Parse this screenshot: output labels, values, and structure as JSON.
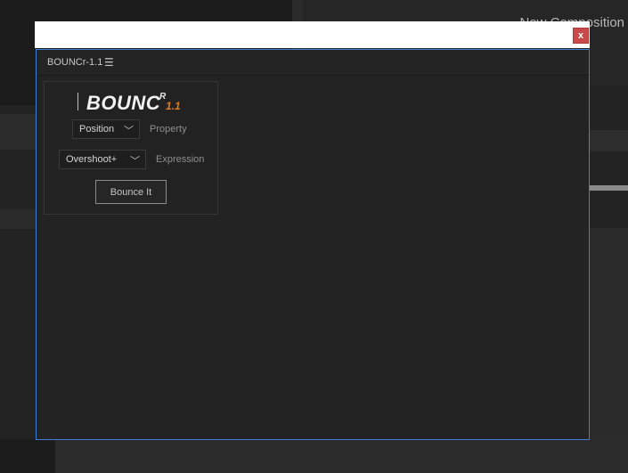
{
  "background": {
    "composition_label": "New Composition"
  },
  "window": {
    "close_label": "x",
    "panel_title": "BOUNCr-1.1",
    "menu_icon": "hamburger-menu-icon",
    "accent_color": "#3f7fd6"
  },
  "logo": {
    "text": "BOUNC",
    "sup": "R",
    "version": "1.1",
    "version_color": "#e07d20"
  },
  "controls": {
    "property_value": "Position",
    "property_label": "Property",
    "expression_value": "Overshoot+",
    "expression_label": "Expression",
    "chevron_icon": "chevron-down-icon",
    "button_label": "Bounce It"
  }
}
